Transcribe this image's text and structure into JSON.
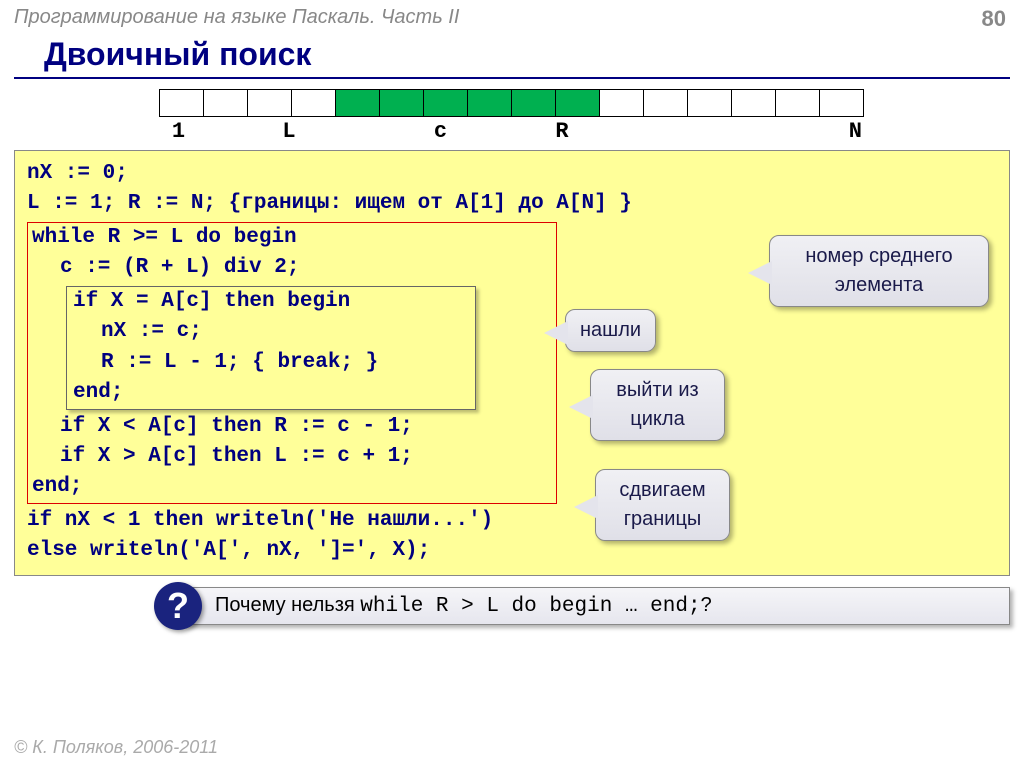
{
  "header": {
    "course": "Программирование на языке Паскаль. Часть II",
    "page": "80"
  },
  "title": "Двоичный поиск",
  "array": {
    "cells": [
      0,
      0,
      0,
      0,
      1,
      1,
      1,
      1,
      1,
      1,
      0,
      0,
      0,
      0,
      0,
      0
    ],
    "labels": {
      "one": "1",
      "L": "L",
      "c": "c",
      "R": "R",
      "N": "N"
    }
  },
  "code": {
    "l1": "nX := 0;",
    "l2a": "L := 1; R := N; ",
    "l2b": "{границы: ищем от A[1] до A[N] }",
    "l3": "while R >= L do begin",
    "l4": "c := (R + L) div 2;",
    "l5": "if X = A[c] then begin",
    "l6": "nX := c;",
    "l7a": "R := L - 1; ",
    "l7b": "{ break; }",
    "l8": "end;",
    "l9": "if X < A[c] then R := c - 1;",
    "l10": "if X > A[c] then L := c + 1;",
    "l11": "end;",
    "l12": "if nX < 1 then writeln('Не нашли...')",
    "l13": "else          writeln('A[', nX, ']=', X);"
  },
  "callouts": {
    "mid": "номер среднего элемента",
    "found": "нашли",
    "exit": "выйти из цикла",
    "shift": "сдвигаем границы"
  },
  "question": {
    "mark": "?",
    "pre": "Почему нельзя ",
    "mono": "while R > L do begin … end;",
    "post": "?"
  },
  "footer": "© К. Поляков, 2006-2011"
}
